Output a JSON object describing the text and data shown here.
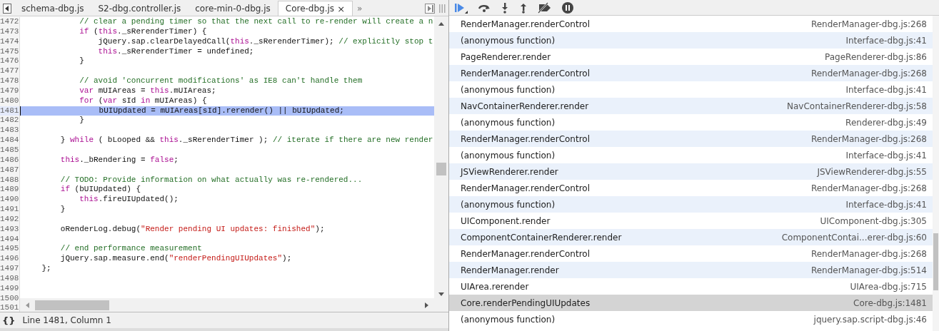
{
  "editor": {
    "tabs": [
      {
        "label": "schema-dbg.js",
        "selected": false
      },
      {
        "label": "S2-dbg.controller.js",
        "selected": false
      },
      {
        "label": "core-min-0-dbg.js",
        "selected": false
      },
      {
        "label": "Core-dbg.js",
        "selected": true
      }
    ],
    "close_glyph": "×",
    "overflow_glyph": "»",
    "lines": [
      {
        "number": "1472",
        "highlighted": false,
        "code": [
          {
            "kind": "comment",
            "text": "            // clear a pending timer so that the next call to re-render will create a n"
          }
        ]
      },
      {
        "number": "1473",
        "highlighted": false,
        "code": [
          {
            "kind": "keyword",
            "text": "            if"
          },
          {
            "kind": "plain",
            "text": " ("
          },
          {
            "kind": "keyword",
            "text": "this"
          },
          {
            "kind": "plain",
            "text": "._sRerenderTimer) {"
          }
        ]
      },
      {
        "number": "1474",
        "highlighted": false,
        "code": [
          {
            "kind": "plain",
            "text": "                jQuery.sap.clearDelayedCall("
          },
          {
            "kind": "keyword",
            "text": "this"
          },
          {
            "kind": "plain",
            "text": "._sRerenderTimer); "
          },
          {
            "kind": "comment",
            "text": "// explicitly stop t"
          }
        ]
      },
      {
        "number": "1475",
        "highlighted": false,
        "code": [
          {
            "kind": "keyword",
            "text": "                this"
          },
          {
            "kind": "plain",
            "text": "._sRerenderTimer = undefined;"
          }
        ]
      },
      {
        "number": "1476",
        "highlighted": false,
        "code": [
          {
            "kind": "plain",
            "text": "            }"
          }
        ]
      },
      {
        "number": "1477",
        "highlighted": false
      },
      {
        "number": "1478",
        "highlighted": false,
        "code": [
          {
            "kind": "comment",
            "text": "            // avoid 'concurrent modifications' as IE8 can't handle them"
          }
        ]
      },
      {
        "number": "1479",
        "highlighted": false,
        "code": [
          {
            "kind": "keyword",
            "text": "            var"
          },
          {
            "kind": "plain",
            "text": " mUIAreas = "
          },
          {
            "kind": "keyword",
            "text": "this"
          },
          {
            "kind": "plain",
            "text": ".mUIAreas;"
          }
        ]
      },
      {
        "number": "1480",
        "highlighted": false,
        "code": [
          {
            "kind": "keyword",
            "text": "            for"
          },
          {
            "kind": "plain",
            "text": " ("
          },
          {
            "kind": "keyword",
            "text": "var"
          },
          {
            "kind": "plain",
            "text": " sId "
          },
          {
            "kind": "keyword",
            "text": "in"
          },
          {
            "kind": "plain",
            "text": " mUIAreas) {"
          }
        ]
      },
      {
        "number": "1481",
        "highlighted": true,
        "code": [
          {
            "kind": "plain",
            "text": "                bUIUpdated = mUIAreas[sId].rerender() || bUIUpdated;"
          }
        ]
      },
      {
        "number": "1482",
        "highlighted": false,
        "code": [
          {
            "kind": "plain",
            "text": "            }"
          }
        ]
      },
      {
        "number": "1483",
        "highlighted": false
      },
      {
        "number": "1484",
        "highlighted": false,
        "code": [
          {
            "kind": "plain",
            "text": "        } "
          },
          {
            "kind": "keyword",
            "text": "while"
          },
          {
            "kind": "plain",
            "text": " ( bLooped && "
          },
          {
            "kind": "keyword",
            "text": "this"
          },
          {
            "kind": "plain",
            "text": "._sRerenderTimer ); "
          },
          {
            "kind": "comment",
            "text": "// iterate if there are new render"
          }
        ]
      },
      {
        "number": "1485",
        "highlighted": false
      },
      {
        "number": "1486",
        "highlighted": false,
        "code": [
          {
            "kind": "keyword",
            "text": "        this"
          },
          {
            "kind": "plain",
            "text": "._bRendering = "
          },
          {
            "kind": "keyword",
            "text": "false"
          },
          {
            "kind": "plain",
            "text": ";"
          }
        ]
      },
      {
        "number": "1487",
        "highlighted": false
      },
      {
        "number": "1488",
        "highlighted": false,
        "code": [
          {
            "kind": "comment",
            "text": "        // TODO: Provide information on what actually was re-rendered..."
          }
        ]
      },
      {
        "number": "1489",
        "highlighted": false,
        "code": [
          {
            "kind": "keyword",
            "text": "        if"
          },
          {
            "kind": "plain",
            "text": " (bUIUpdated) {"
          }
        ]
      },
      {
        "number": "1490",
        "highlighted": false,
        "code": [
          {
            "kind": "keyword",
            "text": "            this"
          },
          {
            "kind": "plain",
            "text": ".fireUIUpdated();"
          }
        ]
      },
      {
        "number": "1491",
        "highlighted": false,
        "code": [
          {
            "kind": "plain",
            "text": "        }"
          }
        ]
      },
      {
        "number": "1492",
        "highlighted": false
      },
      {
        "number": "1493",
        "highlighted": false,
        "code": [
          {
            "kind": "plain",
            "text": "        oRenderLog.debug("
          },
          {
            "kind": "string",
            "text": "\"Render pending UI updates: finished\""
          },
          {
            "kind": "plain",
            "text": ");"
          }
        ]
      },
      {
        "number": "1494",
        "highlighted": false
      },
      {
        "number": "1495",
        "highlighted": false,
        "code": [
          {
            "kind": "comment",
            "text": "        // end performance measurement"
          }
        ]
      },
      {
        "number": "1496",
        "highlighted": false,
        "code": [
          {
            "kind": "plain",
            "text": "        jQuery.sap.measure.end("
          },
          {
            "kind": "string",
            "text": "\"renderPendingUIUpdates\""
          },
          {
            "kind": "plain",
            "text": ");"
          }
        ]
      },
      {
        "number": "1497",
        "highlighted": false,
        "code": [
          {
            "kind": "plain",
            "text": "    };"
          }
        ]
      },
      {
        "number": "1498",
        "highlighted": false
      },
      {
        "number": "1499",
        "highlighted": false
      },
      {
        "number": "1500",
        "highlighted": false
      },
      {
        "number": "1501",
        "highlighted": false
      }
    ],
    "status": {
      "pretty_print": "{}",
      "position": "Line 1481, Column 1"
    }
  },
  "call_stack": [
    {
      "function": "RenderManager.renderControl",
      "location": "RenderManager-dbg.js:268",
      "selected": false
    },
    {
      "function": "(anonymous function)",
      "location": "Interface-dbg.js:41",
      "selected": false
    },
    {
      "function": "PageRenderer.render",
      "location": "PageRenderer-dbg.js:86",
      "selected": false
    },
    {
      "function": "RenderManager.renderControl",
      "location": "RenderManager-dbg.js:268",
      "selected": false
    },
    {
      "function": "(anonymous function)",
      "location": "Interface-dbg.js:41",
      "selected": false
    },
    {
      "function": "NavContainerRenderer.render",
      "location": "NavContainerRenderer-dbg.js:58",
      "selected": false
    },
    {
      "function": "(anonymous function)",
      "location": "Renderer-dbg.js:49",
      "selected": false
    },
    {
      "function": "RenderManager.renderControl",
      "location": "RenderManager-dbg.js:268",
      "selected": false
    },
    {
      "function": "(anonymous function)",
      "location": "Interface-dbg.js:41",
      "selected": false
    },
    {
      "function": "JSViewRenderer.render",
      "location": "JSViewRenderer-dbg.js:55",
      "selected": false
    },
    {
      "function": "RenderManager.renderControl",
      "location": "RenderManager-dbg.js:268",
      "selected": false
    },
    {
      "function": "(anonymous function)",
      "location": "Interface-dbg.js:41",
      "selected": false
    },
    {
      "function": "UIComponent.render",
      "location": "UIComponent-dbg.js:305",
      "selected": false
    },
    {
      "function": "ComponentContainerRenderer.render",
      "location": "ComponentContai...erer-dbg.js:60",
      "selected": false
    },
    {
      "function": "RenderManager.renderControl",
      "location": "RenderManager-dbg.js:268",
      "selected": false
    },
    {
      "function": "RenderManager.render",
      "location": "RenderManager-dbg.js:514",
      "selected": false
    },
    {
      "function": "UIArea.rerender",
      "location": "UIArea-dbg.js:715",
      "selected": false
    },
    {
      "function": "Core.renderPendingUIUpdates",
      "location": "Core-dbg.js:1481",
      "selected": true
    },
    {
      "function": "(anonymous function)",
      "location": "jquery.sap.script-dbg.js:46",
      "selected": false
    }
  ]
}
